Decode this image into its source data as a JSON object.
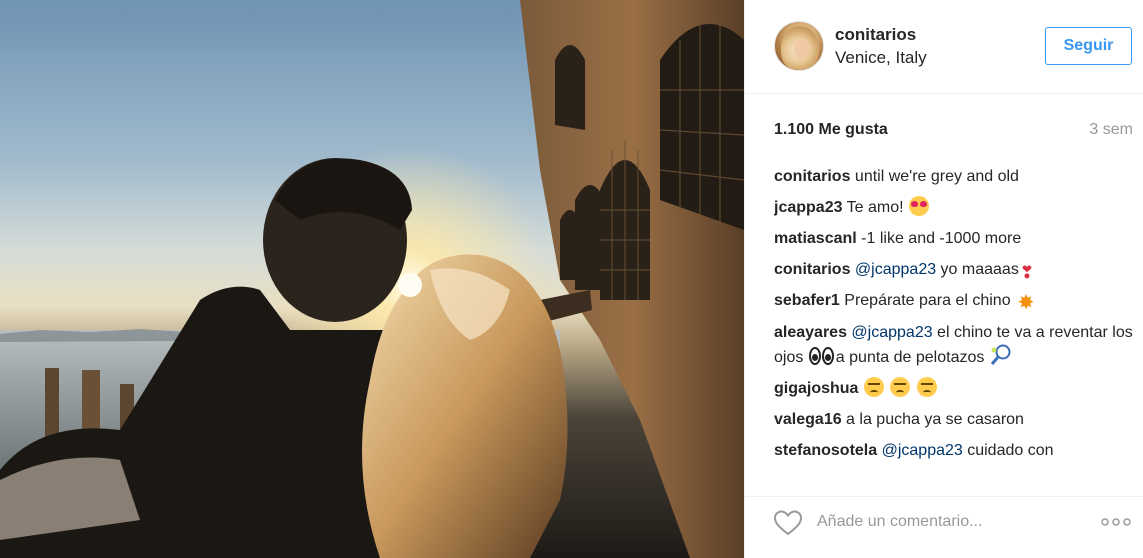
{
  "post": {
    "user": {
      "username": "conitarios",
      "location": "Venice, Italy",
      "follow_label": "Seguir"
    },
    "likes": "1.100 Me gusta",
    "age": "3 sem",
    "comments": [
      {
        "user": "conitarios",
        "text": " until we're grey and old"
      },
      {
        "user": "jcappa23",
        "text": " Te amo! "
      },
      {
        "user": "matiascanl",
        "text": " -1 like and -1000 more"
      },
      {
        "user": "conitarios",
        "mention": "@jcappa23",
        "text": " yo maaaas"
      },
      {
        "user": "sebafer1",
        "text": " Prepárate para el chino "
      },
      {
        "user": "aleayares",
        "mention": "@jcappa23",
        "text": " el chino te va a reventar los ojos ",
        "text2": "a punta de pelotazos "
      },
      {
        "user": "gigajoshua",
        "text": " "
      },
      {
        "user": "valega16",
        "text": " a la pucha ya se casaron"
      },
      {
        "user": "stefanosotela",
        "mention": "@jcappa23",
        "text": " cuidado con"
      }
    ],
    "comment_placeholder": "Añade un comentario...",
    "icons": {
      "like": "heart-outline-icon",
      "more": "more-options-icon"
    },
    "colors": {
      "accent": "#3897f0",
      "mention": "#003569",
      "muted": "#999999"
    }
  }
}
